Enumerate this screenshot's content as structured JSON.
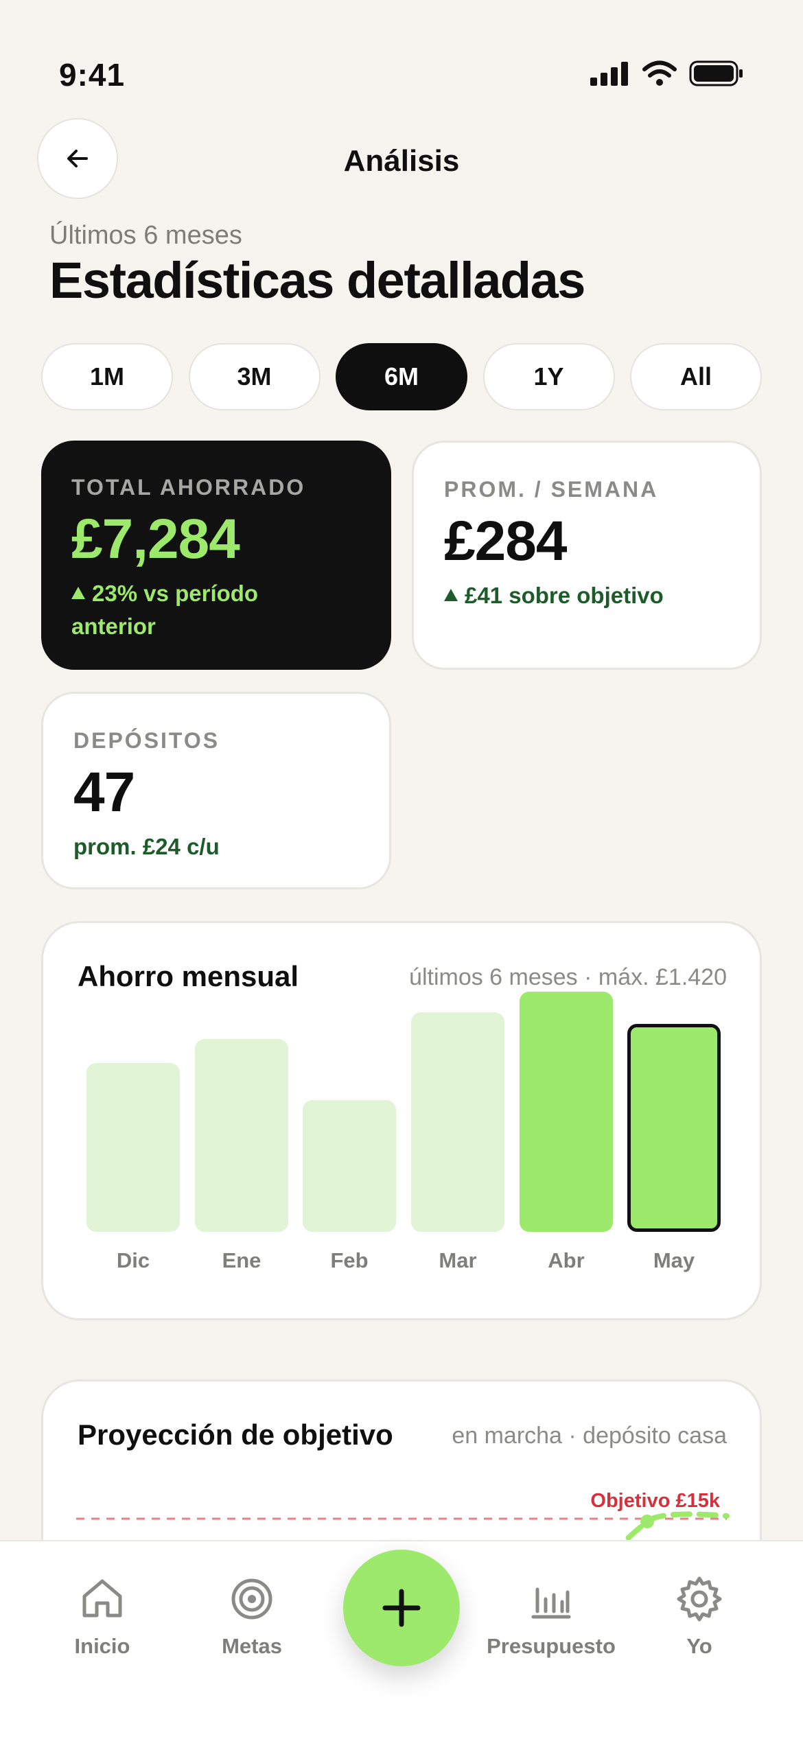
{
  "status_bar": {
    "time": "9:41"
  },
  "nav": {
    "title": "Análisis"
  },
  "header": {
    "subtitle": "Últimos 6 meses",
    "title": "Estadísticas detalladas"
  },
  "ranges": [
    {
      "label": "1M",
      "active": false
    },
    {
      "label": "3M",
      "active": false
    },
    {
      "label": "6M",
      "active": true
    },
    {
      "label": "1Y",
      "active": false
    },
    {
      "label": "All",
      "active": false
    }
  ],
  "stats": {
    "total": {
      "label": "TOTAL AHORRADO",
      "value": "£7,284",
      "sub_line1": "23% vs período",
      "sub_line2": "anterior"
    },
    "weekly": {
      "label": "PROM. / SEMANA",
      "value": "£284",
      "sub": "£41 sobre objetivo"
    },
    "deposits": {
      "label": "DEPÓSITOS",
      "value": "47",
      "sub": "prom. £24 c/u"
    }
  },
  "monthly_chart": {
    "title": "Ahorro mensual",
    "meta": "últimos 6 meses · máx. £1.420"
  },
  "chart_data": {
    "type": "bar",
    "categories": [
      "Dic",
      "Ene",
      "Feb",
      "Mar",
      "Abr",
      "May"
    ],
    "values": [
      1000,
      1140,
      780,
      1300,
      1420,
      1230
    ],
    "ylim": [
      0,
      1420
    ],
    "highlighted": [
      "Abr",
      "May"
    ],
    "selected": "May"
  },
  "projection": {
    "title": "Proyección de objetivo",
    "meta": "en marcha · depósito casa",
    "goal_label": "Objetivo £15k"
  },
  "tabbar": {
    "items": [
      {
        "label": "Inicio",
        "icon": "home-icon"
      },
      {
        "label": "Metas",
        "icon": "target-icon"
      },
      {
        "label": "Presupuesto",
        "icon": "bar-chart-icon"
      },
      {
        "label": "Yo",
        "icon": "gear-icon"
      }
    ],
    "fab_icon": "plus-icon"
  },
  "colors": {
    "accent": "#9de96b",
    "accent_light": "#e1f4d6",
    "dark": "#111111",
    "positive_text": "#1d5b2a",
    "goal": "#d6303a"
  }
}
